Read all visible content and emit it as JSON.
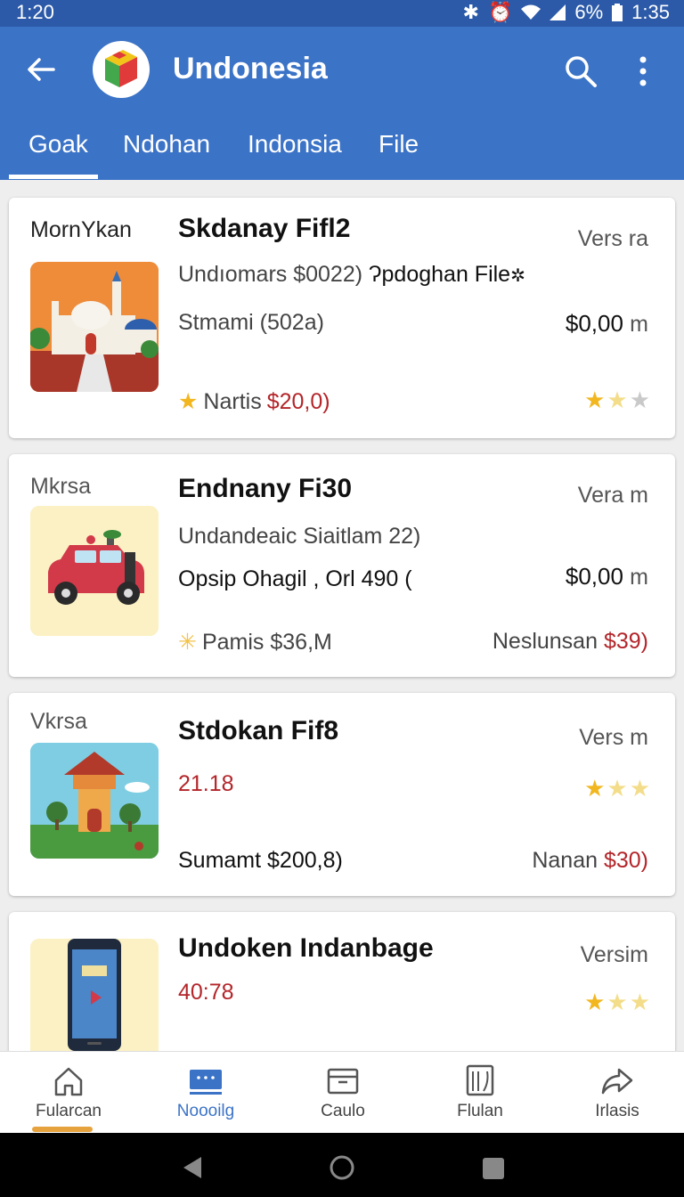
{
  "status": {
    "time_left": "1:20",
    "battery": "6%",
    "time_right": "1:35"
  },
  "appbar": {
    "title": "Undonesia"
  },
  "tabs": [
    {
      "label": "Goak"
    },
    {
      "label": "Ndohan"
    },
    {
      "label": "Indonsia"
    },
    {
      "label": "File"
    }
  ],
  "cards": [
    {
      "label": "MornYkan",
      "name": "Skdanay Fifl2",
      "version": "Vers ra",
      "subtitle": "Undıomars $0022) ",
      "subtitle_bold": "Ɂpdoghan File",
      "line2": "Stmami (502a)",
      "price": "$0,00",
      "price_unit": "m",
      "rating_label": "Nartis",
      "rating_value": "$20,0)",
      "stars": 1.5
    },
    {
      "label": "Mkrsa",
      "name": "Endnany Fi30",
      "version": "Vera m",
      "subtitle": "Undandeaic Siaitlam 22)",
      "line2": "Opsip Ohagil , Orl 490 (",
      "price": "$0,00",
      "price_unit": "m",
      "rating_label": "Pamis $36,M",
      "right_label": "Neslunsan",
      "right_value": "$39)"
    },
    {
      "label": "Vkrsa",
      "name": "Stdokan Fif8",
      "version": "Vers m",
      "subtitle_red": "21.18",
      "line2": "Sumamt $200,8)",
      "right_label": "Nanan",
      "right_value": "$30)",
      "stars": 1
    },
    {
      "name": "Undoken Indanbage",
      "version": "Versim",
      "subtitle_red": "40:78",
      "stars": 1
    }
  ],
  "bottom_nav": [
    {
      "label": "Fularcan",
      "icon": "home-icon"
    },
    {
      "label": "Noooilg",
      "icon": "keyboard-icon"
    },
    {
      "label": "Caulo",
      "icon": "inbox-icon"
    },
    {
      "label": "Flulan",
      "icon": "book-icon"
    },
    {
      "label": "Irlasis",
      "icon": "share-icon"
    }
  ],
  "colors": {
    "appbar": "#3b73c7",
    "statusbar": "#2c5aa8",
    "accent_red": "#b3252a",
    "star": "#f2b61f"
  }
}
